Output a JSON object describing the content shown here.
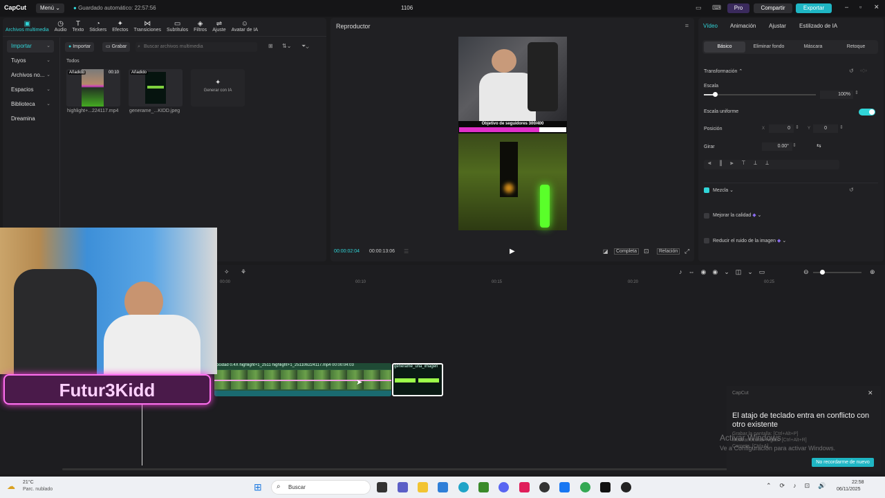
{
  "app": {
    "logo": "CapCut",
    "menu_label": "Menú",
    "autosave": "Guardado automático: 22:57:56",
    "project_title": "1106",
    "pro_label": "Pro",
    "share_label": "Compartir",
    "export_label": "Exportar"
  },
  "toolbar": [
    {
      "label": "Archivos multimedia",
      "icon": "media-icon",
      "glyph": "▣",
      "active": true
    },
    {
      "label": "Audio",
      "icon": "audio-icon",
      "glyph": "◷"
    },
    {
      "label": "Texto",
      "icon": "text-icon",
      "glyph": "T"
    },
    {
      "label": "Stickers",
      "icon": "sticker-icon",
      "glyph": "◔"
    },
    {
      "label": "Efectos",
      "icon": "effects-icon",
      "glyph": "✦"
    },
    {
      "label": "Transiciones",
      "icon": "transitions-icon",
      "glyph": "⋈"
    },
    {
      "label": "Subtítulos",
      "icon": "subtitles-icon",
      "glyph": "▭"
    },
    {
      "label": "Filtros",
      "icon": "filters-icon",
      "glyph": "◈"
    },
    {
      "label": "Ajuste",
      "icon": "adjust-icon",
      "glyph": "⇌"
    },
    {
      "label": "Avatar de IA",
      "icon": "ai-avatar-icon",
      "glyph": "☺"
    }
  ],
  "leftnav": [
    {
      "label": "Importar",
      "chev": "⌄",
      "selected": true
    },
    {
      "label": "Tuyos",
      "chev": "⌄"
    },
    {
      "label": "Archivos no...",
      "chev": "⌄"
    },
    {
      "label": "Espacios",
      "chev": "⌄"
    },
    {
      "label": "Biblioteca",
      "chev": "⌄"
    },
    {
      "label": "Dreamina",
      "chev": ""
    }
  ],
  "media": {
    "import_label": "Importar",
    "record_label": "Grabar",
    "search_placeholder": "Buscar archivos multimedia",
    "section": "Todos",
    "items": [
      {
        "tag": "Añadido",
        "duration": "00:10",
        "name": "highlight+...224117.mp4"
      },
      {
        "tag": "Añadido",
        "duration": "",
        "name": "generame_...KIDD.jpeg"
      }
    ],
    "ai_generate": "Generar con IA"
  },
  "player": {
    "title": "Reproductor",
    "goal_text": "Objetivo de seguidores 300/400",
    "goal_fraction": 0.75,
    "current_time": "00:00:02:04",
    "total_time": "00:00:13:06",
    "full_label": "Completa",
    "ratio_label": "Relación"
  },
  "inspector": {
    "tabs": [
      "Vídeo",
      "Animación",
      "Ajustar",
      "Estilizado de IA"
    ],
    "subtabs": [
      "Básico",
      "Eliminar fondo",
      "Máscara",
      "Retoque"
    ],
    "transform_label": "Transformación",
    "scale_label": "Escala",
    "scale_value": "100%",
    "scale_level": 0.1,
    "uniform_label": "Escala uniforme",
    "position_label": "Posición",
    "pos_x_label": "X",
    "pos_x": "0",
    "pos_y_label": "Y",
    "pos_y": "0",
    "rotate_label": "Girar",
    "rotate_value": "0.00°",
    "blend_label": "Mezcla",
    "enhance_label": "Mejorar la calidad",
    "denoise_label": "Reducir el ruido de la imagen"
  },
  "timeline": {
    "ticks": [
      "00:00",
      "00:10",
      "00:15",
      "00:20",
      "00:25"
    ],
    "clip_labels": [
      "ocidad 0.4X  highlight+1_2511",
      "highlight+1_251106224117.mp4  00:00:04:03",
      "generame_una_imagen"
    ],
    "overlay_name": "Futur3Kidd"
  },
  "notification": {
    "app": "CapCut",
    "message": "El atajo de teclado entra en conflicto con otro existente",
    "detail_1": "Grabar la pantalla: [Ctrl+Alt+P]",
    "detail_2": "Mostrar/ocultar reglas: [Ctrl+Alt+R]",
    "detail_3": "Carpeta: [Ctrl+A]",
    "button": "No recordarme de nuevo",
    "watermark_1": "Activar Windows",
    "watermark_2": "Ve a Configuración para activar Windows."
  },
  "taskbar": {
    "weather_temp": "21°C",
    "weather_desc": "Parc. nublado",
    "search_label": "Buscar",
    "time": "22:58",
    "date": "06/11/2025"
  },
  "colors": {
    "accent": "#30d5d8",
    "export": "#1fb6c4",
    "pink": "#e030c8"
  }
}
